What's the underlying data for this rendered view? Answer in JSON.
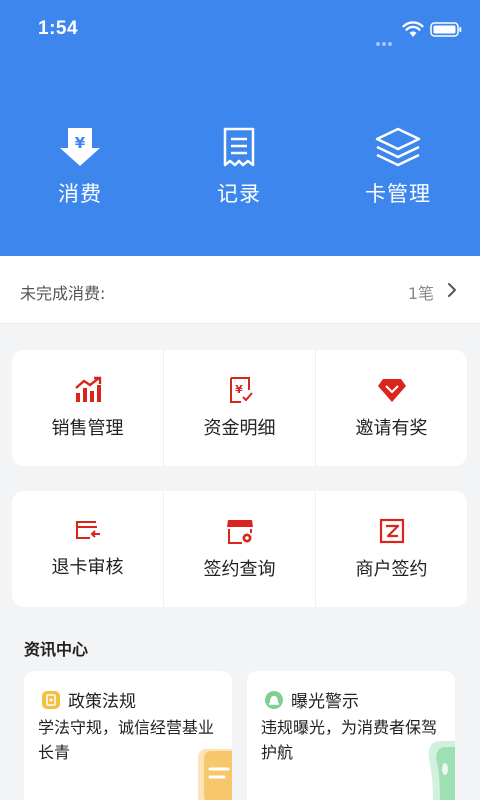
{
  "status_bar": {
    "time": "1:54"
  },
  "quick_actions": [
    {
      "label": "消费",
      "icon": "yuan-download-icon"
    },
    {
      "label": "记录",
      "icon": "receipt-icon"
    },
    {
      "label": "卡管理",
      "icon": "layers-icon"
    }
  ],
  "pending": {
    "label": "未完成消费:",
    "count": "1笔"
  },
  "grid_top": [
    {
      "label": "销售管理",
      "icon": "sales-chart-icon"
    },
    {
      "label": "资金明细",
      "icon": "funds-receipt-icon"
    },
    {
      "label": "邀请有奖",
      "icon": "diamond-icon"
    }
  ],
  "grid_bottom": [
    {
      "label": "退卡审核",
      "icon": "card-return-icon"
    },
    {
      "label": "签约查询",
      "icon": "store-search-icon"
    },
    {
      "label": "商户签约",
      "icon": "merchant-sign-icon"
    }
  ],
  "news": {
    "title": "资讯中心",
    "items": [
      {
        "title": "政策法规",
        "desc": "学法守规，诚信经营基业长青",
        "icon": "policy-icon"
      },
      {
        "title": "曝光警示",
        "desc": "违规曝光，为消费者保驾护航",
        "icon": "warning-bell-icon"
      }
    ]
  },
  "colors": {
    "header": "#3c86ee",
    "accent_red": "#d9251c",
    "policy_badge": "#f3bf3f",
    "warning_badge": "#7fcf94"
  }
}
